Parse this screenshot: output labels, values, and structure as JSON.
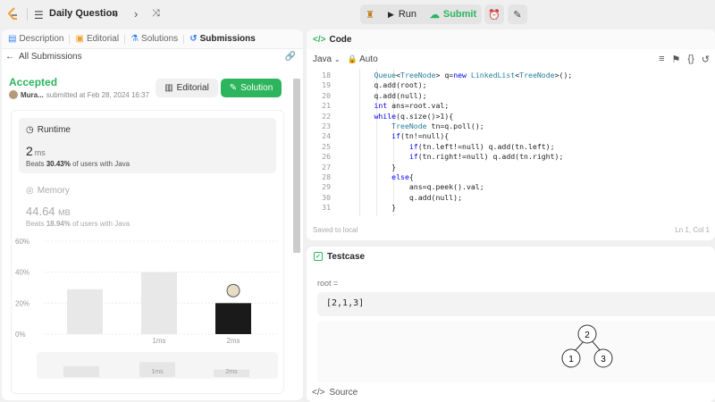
{
  "topbar": {
    "title": "Daily Question",
    "run_label": "Run",
    "submit_label": "Submit",
    "prev_icon": "chevron-left-icon",
    "next_icon": "chevron-right-icon",
    "shuffle_icon": "shuffle-icon"
  },
  "left_tabs": [
    {
      "label": "Description"
    },
    {
      "label": "Editorial"
    },
    {
      "label": "Solutions"
    },
    {
      "label": "Submissions"
    }
  ],
  "submission": {
    "back_label": "All Submissions",
    "status": "Accepted",
    "user": "Mura...",
    "submitted_at": "submitted at Feb 28, 2024 16:37",
    "editorial_button": "Editorial",
    "solution_button": "Solution"
  },
  "runtime": {
    "title": "Runtime",
    "value": "2",
    "unit": "ms",
    "beats_prefix": "Beats",
    "beats_value": "30.43%",
    "beats_suffix": "of users with Java"
  },
  "memory": {
    "title": "Memory",
    "value": "44.64",
    "unit": "MB",
    "beats_prefix": "Beats",
    "beats_value": "18.94%",
    "beats_suffix": "of users with Java"
  },
  "chart_data": {
    "type": "bar",
    "categories": [
      "",
      "1ms",
      "2ms"
    ],
    "values": [
      29,
      40,
      20
    ],
    "highlight_index": 2,
    "yticks": [
      "0%",
      "20%",
      "40%",
      "60%"
    ],
    "ylim": [
      0,
      60
    ],
    "mini_categories": [
      "",
      "1ms",
      "2ms"
    ],
    "mini_values": [
      29,
      40,
      20
    ],
    "colors": {
      "bar": "#e8e8e8",
      "highlight": "#1a1a1a",
      "grid": "#ececec"
    }
  },
  "code": {
    "title": "Code",
    "language": "Java",
    "mode": "Auto",
    "lines": [
      {
        "n": "18",
        "code": "        Queue<TreeNode> q=new LinkedList<TreeNode>();"
      },
      {
        "n": "19",
        "code": "        q.add(root);"
      },
      {
        "n": "20",
        "code": "        q.add(null);"
      },
      {
        "n": "21",
        "code": "        int ans=root.val;"
      },
      {
        "n": "22",
        "code": "        while(q.size()>1){"
      },
      {
        "n": "23",
        "code": "            TreeNode tn=q.poll();"
      },
      {
        "n": "24",
        "code": "            if(tn!=null){"
      },
      {
        "n": "25",
        "code": "                if(tn.left!=null) q.add(tn.left);"
      },
      {
        "n": "26",
        "code": "                if(tn.right!=null) q.add(tn.right);"
      },
      {
        "n": "27",
        "code": "            }"
      },
      {
        "n": "28",
        "code": "            else{"
      },
      {
        "n": "29",
        "code": "                ans=q.peek().val;"
      },
      {
        "n": "30",
        "code": "                q.add(null);"
      },
      {
        "n": "31",
        "code": "            }"
      }
    ],
    "saved": "Saved to local",
    "cursor": "Ln 1, Col 1"
  },
  "testcase": {
    "title": "Testcase",
    "param_label": "root =",
    "param_value": "[2,1,3]",
    "tree_nodes": [
      "2",
      "1",
      "3"
    ],
    "source_label": "Source"
  }
}
